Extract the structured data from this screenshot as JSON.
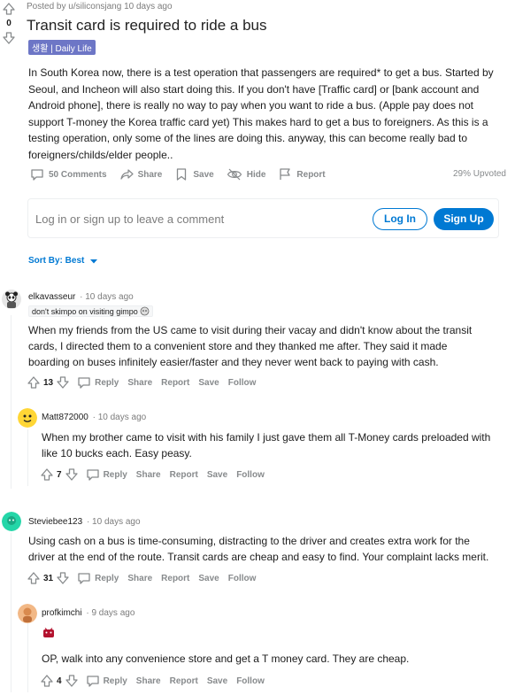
{
  "post": {
    "vote_count": "0",
    "meta": "Posted by u/siliconsjang 10 days ago",
    "title": "Transit card is required to ride a bus",
    "flair": "생활 | Daily Life",
    "body": "In South Korea now, there is a test operation that passengers are required* to get a bus. Started by Seoul, and Incheon will also start doing this. If you don't have [Traffic card] or [bank account and Android phone], there is really no way to pay when you want to ride a bus. (Apple pay does not support T-money the Korea traffic card yet) This makes hard to get a bus to foreigners. As this is a testing operation, only some of the lines are doing this. anyway, this can become really bad to foreigners/childs/elder people..",
    "actions": {
      "comments": "50 Comments",
      "share": "Share",
      "save": "Save",
      "hide": "Hide",
      "report": "Report"
    },
    "upvoted": "29% Upvoted"
  },
  "login_prompt": {
    "text": "Log in or sign up to leave a comment",
    "login": "Log In",
    "signup": "Sign Up"
  },
  "sort": {
    "label": "Sort By: Best"
  },
  "comment_actions": {
    "reply": "Reply",
    "share": "Share",
    "report": "Report",
    "save": "Save",
    "follow": "Follow"
  },
  "comments": [
    {
      "author": "elkavasseur",
      "time": "· 10 days ago",
      "flair": "don't skimpo on visiting gimpo",
      "text": "When my friends from the US came to visit during their vacay and didn't know about the transit cards, I directed them to a convenient store and they thanked me after. They said it made boarding on buses infinitely easier/faster and they never went back to paying with cash.",
      "votes": "13"
    },
    {
      "author": "Matt872000",
      "time": "· 10 days ago",
      "text": "When my brother came to visit with his family I just gave them all T-Money cards preloaded with like 10 bucks each. Easy peasy.",
      "votes": "7"
    },
    {
      "author": "Steviebee123",
      "time": "· 10 days ago",
      "text": "Using cash on a bus is time-consuming, distracting to the driver and creates extra work for the driver at the end of the route. Transit cards are cheap and easy to find. Your complaint lacks merit.",
      "votes": "31"
    },
    {
      "author": "profkimchi",
      "time": "· 9 days ago",
      "text": "OP, walk into any convenience store and get a T money card. They are cheap.",
      "votes": "4"
    }
  ],
  "colors": {
    "accent": "#0079d3",
    "flair_bg": "#6d76c6",
    "muted": "#878a8c"
  }
}
